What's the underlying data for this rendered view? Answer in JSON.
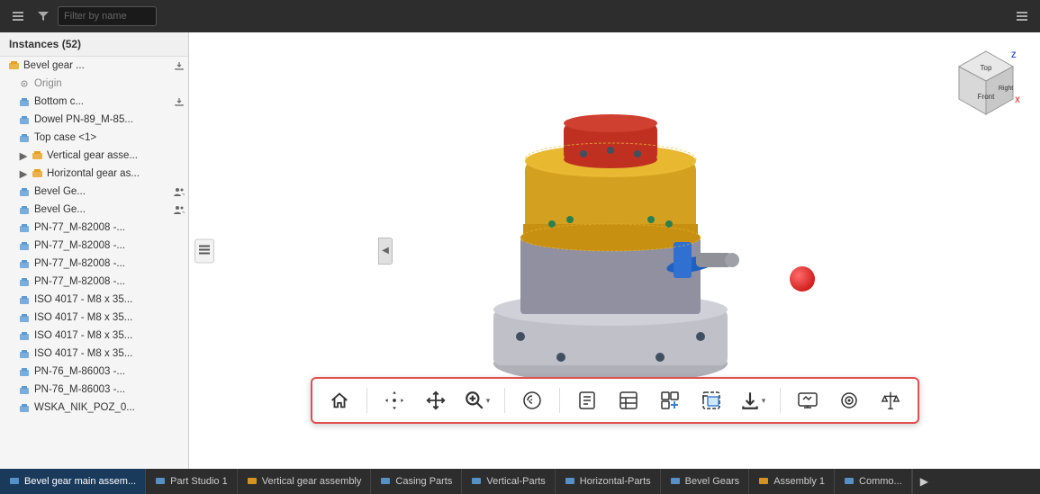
{
  "toolbar": {
    "filter_placeholder": "Filter by name"
  },
  "left_panel": {
    "instances_label": "Instances (52)",
    "tree_items": [
      {
        "id": "bevel-gear",
        "label": "Bevel gear ...",
        "indent": 0,
        "type": "assembly",
        "badge": "export",
        "expandable": false
      },
      {
        "id": "origin",
        "label": "Origin",
        "indent": 1,
        "type": "origin",
        "expandable": false
      },
      {
        "id": "bottom-c",
        "label": "Bottom c...",
        "indent": 1,
        "type": "part",
        "badge": "export2",
        "expandable": false
      },
      {
        "id": "dowel",
        "label": "Dowel PN-89_M-85...",
        "indent": 1,
        "type": "part",
        "expandable": false
      },
      {
        "id": "top-case",
        "label": "Top case <1>",
        "indent": 1,
        "type": "part",
        "expandable": false
      },
      {
        "id": "vertical-gear",
        "label": "Vertical gear asse...",
        "indent": 1,
        "type": "assembly",
        "expandable": true
      },
      {
        "id": "horizontal-gear",
        "label": "Horizontal gear as...",
        "indent": 1,
        "type": "assembly",
        "expandable": true
      },
      {
        "id": "bevel-ge-1",
        "label": "Bevel Ge...",
        "indent": 1,
        "type": "part",
        "badge": "people",
        "expandable": false
      },
      {
        "id": "bevel-ge-2",
        "label": "Bevel Ge...",
        "indent": 1,
        "type": "part",
        "badge": "people",
        "expandable": false
      },
      {
        "id": "pn-77-1",
        "label": "PN-77_M-82008 -...",
        "indent": 1,
        "type": "part",
        "expandable": false
      },
      {
        "id": "pn-77-2",
        "label": "PN-77_M-82008 -...",
        "indent": 1,
        "type": "part",
        "expandable": false
      },
      {
        "id": "pn-77-3",
        "label": "PN-77_M-82008 -...",
        "indent": 1,
        "type": "part",
        "expandable": false
      },
      {
        "id": "pn-77-4",
        "label": "PN-77_M-82008 -...",
        "indent": 1,
        "type": "part",
        "expandable": false
      },
      {
        "id": "iso-1",
        "label": "ISO 4017 - M8 x 35...",
        "indent": 1,
        "type": "part",
        "expandable": false
      },
      {
        "id": "iso-2",
        "label": "ISO 4017 - M8 x 35...",
        "indent": 1,
        "type": "part",
        "expandable": false
      },
      {
        "id": "iso-3",
        "label": "ISO 4017 - M8 x 35...",
        "indent": 1,
        "type": "part",
        "expandable": false
      },
      {
        "id": "iso-4",
        "label": "ISO 4017 - M8 x 35...",
        "indent": 1,
        "type": "part",
        "expandable": false
      },
      {
        "id": "pn-76-1",
        "label": "PN-76_M-86003 -...",
        "indent": 1,
        "type": "part",
        "expandable": false
      },
      {
        "id": "pn-76-2",
        "label": "PN-76_M-86003 -...",
        "indent": 1,
        "type": "part",
        "expandable": false
      },
      {
        "id": "wska",
        "label": "WSKA_NIK_POZ_0...",
        "indent": 1,
        "type": "part",
        "expandable": false
      }
    ]
  },
  "bottom_toolbar": {
    "buttons": [
      {
        "id": "home",
        "icon": "⌂",
        "label": "Home"
      },
      {
        "id": "transform",
        "icon": "✥",
        "label": "Transform"
      },
      {
        "id": "move",
        "icon": "✛",
        "label": "Move"
      },
      {
        "id": "zoom",
        "icon": "⊕",
        "label": "Zoom",
        "has_arrow": true
      },
      {
        "id": "fingerprint",
        "icon": "◈",
        "label": "Fingerprint"
      },
      {
        "id": "document",
        "icon": "▤",
        "label": "Document"
      },
      {
        "id": "list",
        "icon": "☰",
        "label": "List"
      },
      {
        "id": "link",
        "icon": "⧉",
        "label": "Link"
      },
      {
        "id": "crop",
        "icon": "⊡",
        "label": "Crop"
      },
      {
        "id": "download",
        "icon": "⬇",
        "label": "Download",
        "has_arrow": true
      },
      {
        "id": "screen",
        "icon": "▣",
        "label": "Screen"
      },
      {
        "id": "coil",
        "icon": "◎",
        "label": "Coil"
      },
      {
        "id": "scale",
        "icon": "⚖",
        "label": "Scale"
      }
    ]
  },
  "tabs": [
    {
      "id": "bevel-gear-main",
      "label": "Bevel gear main assem...",
      "active": true
    },
    {
      "id": "part-studio-1",
      "label": "Part Studio 1",
      "active": false
    },
    {
      "id": "vertical-gear-assembly",
      "label": "Vertical gear assembly",
      "active": false
    },
    {
      "id": "casing-parts",
      "label": "Casing Parts",
      "active": false
    },
    {
      "id": "vertical-parts",
      "label": "Vertical-Parts",
      "active": false
    },
    {
      "id": "horizontal-parts",
      "label": "Horizontal-Parts",
      "active": false
    },
    {
      "id": "bevel-gears",
      "label": "Bevel Gears",
      "active": false
    },
    {
      "id": "assembly-1",
      "label": "Assembly 1",
      "active": false
    },
    {
      "id": "common",
      "label": "Commo...",
      "active": false
    }
  ],
  "viewport": {
    "background": "#ffffff"
  }
}
